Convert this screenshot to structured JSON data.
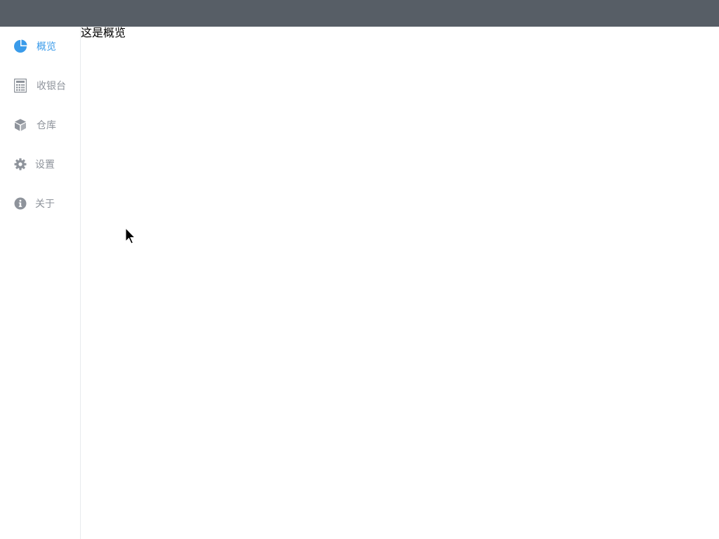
{
  "sidebar": {
    "items": [
      {
        "label": "概览",
        "icon": "pie-chart-icon",
        "active": true
      },
      {
        "label": "收银台",
        "icon": "calculator-icon",
        "active": false
      },
      {
        "label": "仓库",
        "icon": "cube-icon",
        "active": false
      },
      {
        "label": "设置",
        "icon": "gear-icon",
        "active": false
      },
      {
        "label": "关于",
        "icon": "info-icon",
        "active": false
      }
    ]
  },
  "main": {
    "text": "这是概览"
  },
  "colors": {
    "topbar": "#575e66",
    "accent": "#3a9bea",
    "muted": "#8e939b"
  }
}
